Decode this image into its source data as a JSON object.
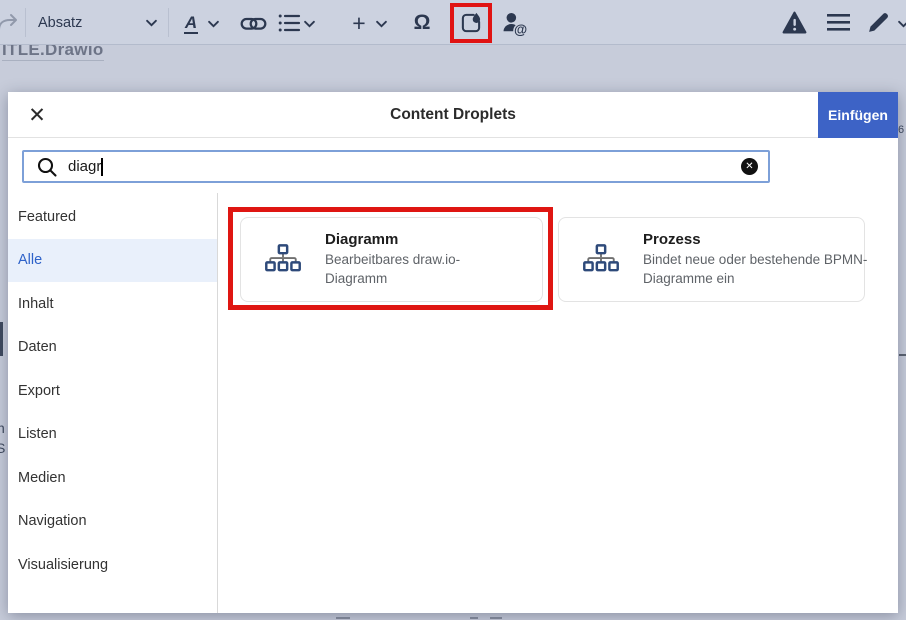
{
  "toolbar": {
    "paragraph_label": "Absatz",
    "font_color_glyph": "A",
    "insert_glyph": "+",
    "special_char_glyph": "Ω"
  },
  "background": {
    "clipped_heading": "ITLE.Drawio",
    "edge_fragment_n": "n",
    "edge_fragment_s": "S",
    "edge_fragment_6": "6"
  },
  "modal": {
    "title": "Content Droplets",
    "insert_button_label": "Einfügen",
    "close_glyph": "✕",
    "clear_glyph": "✕",
    "search": {
      "value": "diagr"
    },
    "sidebar": {
      "items": [
        "Featured",
        "Alle",
        "Inhalt",
        "Daten",
        "Export",
        "Listen",
        "Medien",
        "Navigation",
        "Visualisierung"
      ],
      "selected": "Alle"
    },
    "cards": [
      {
        "title": "Diagramm",
        "description": "Bearbeitbares draw.io-Diagramm",
        "highlighted": true
      },
      {
        "title": "Prozess",
        "description": "Bindet neue oder bestehende BPMN-Diagramme ein",
        "highlighted": false
      }
    ]
  },
  "colors": {
    "accent_blue": "#3d63c6",
    "selected_text_blue": "#2e62c9",
    "selected_bg_blue": "#e9f0fb",
    "annotation_red": "#e01313",
    "diagram_icon_navy": "#2e4a7a",
    "toolbar_bg": "#ccd2e0",
    "overlay_bg": "#c7ccda"
  }
}
